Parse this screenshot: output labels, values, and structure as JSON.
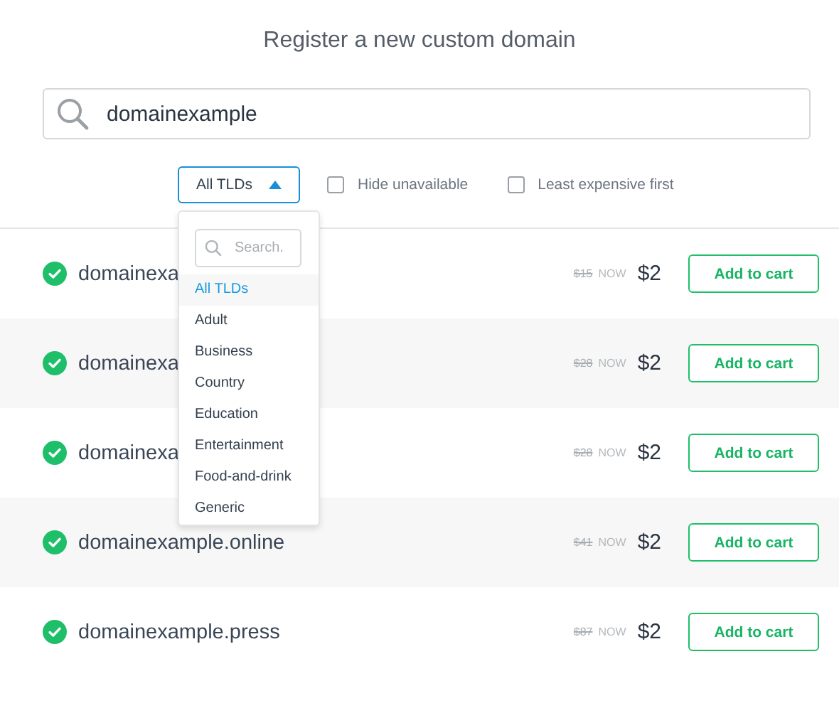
{
  "title": "Register a new custom domain",
  "search": {
    "value": "domainexample"
  },
  "filters": {
    "tld_select": {
      "label": "All TLDs",
      "expanded": true
    },
    "options": [
      {
        "label": "Hide unavailable",
        "checked": false
      },
      {
        "label": "Least expensive first",
        "checked": false
      }
    ]
  },
  "dropdown": {
    "search": {
      "placeholder": "Search."
    },
    "items": [
      {
        "label": "All TLDs",
        "selected": true
      },
      {
        "label": "Adult",
        "selected": false
      },
      {
        "label": "Business",
        "selected": false
      },
      {
        "label": "Country",
        "selected": false
      },
      {
        "label": "Education",
        "selected": false
      },
      {
        "label": "Entertainment",
        "selected": false
      },
      {
        "label": "Food-and-drink",
        "selected": false
      },
      {
        "label": "Generic",
        "selected": false
      }
    ]
  },
  "results": [
    {
      "name": "domainexa",
      "available": true,
      "old_price": "$15",
      "now": "NOW",
      "price": "$2",
      "button": "Add to cart"
    },
    {
      "name": "domainexa",
      "available": true,
      "old_price": "$28",
      "now": "NOW",
      "price": "$2",
      "button": "Add to cart"
    },
    {
      "name": "domainexa",
      "available": true,
      "old_price": "$28",
      "now": "NOW",
      "price": "$2",
      "button": "Add to cart"
    },
    {
      "name": "domainexample.online",
      "available": true,
      "old_price": "$41",
      "now": "NOW",
      "price": "$2",
      "button": "Add to cart"
    },
    {
      "name": "domainexample.press",
      "available": true,
      "old_price": "$87",
      "now": "NOW",
      "price": "$2",
      "button": "Add to cart"
    }
  ]
}
